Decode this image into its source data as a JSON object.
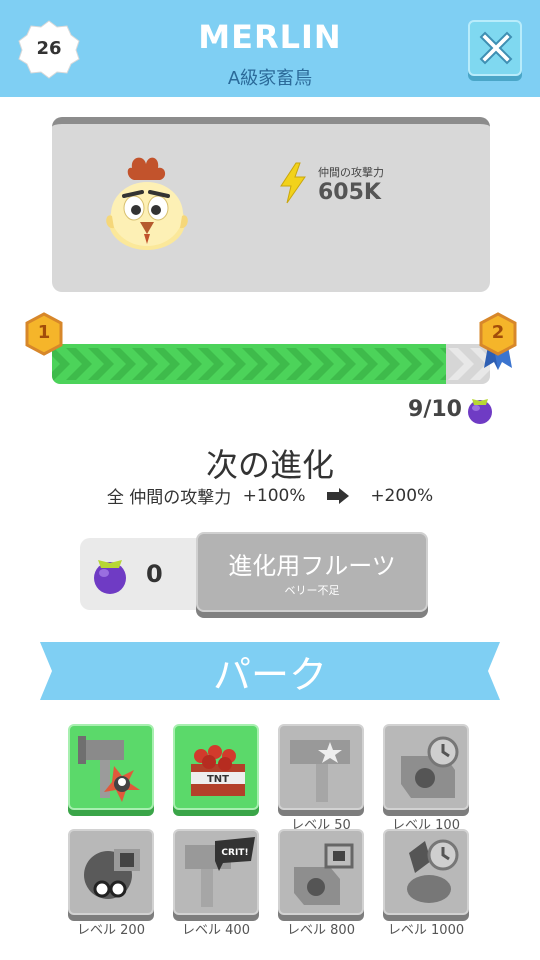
{
  "header": {
    "level": "26",
    "hero_name": "MERLIN",
    "hero_rank": "A級家畜鳥"
  },
  "hero_card": {
    "power_label": "仲間の攻撃力",
    "power_value": "605K"
  },
  "progress": {
    "current": 9,
    "max": 10,
    "count_text": "9/10",
    "from_milestone": "1",
    "to_milestone": "2"
  },
  "next_evolution": {
    "title": "次の進化",
    "bonus_prefix": "全 仲間の攻撃力",
    "bonus_from": "+100%",
    "bonus_to": "+200%"
  },
  "fruit": {
    "count": "0",
    "button_label": "進化用フルーツ",
    "button_sublabel": "ベリー不足"
  },
  "perks": {
    "title": "パーク",
    "tiles": [
      {
        "name": "hammer-crow-perk",
        "state": "unlocked",
        "label": ""
      },
      {
        "name": "tnt-perk",
        "state": "unlocked",
        "label": ""
      },
      {
        "name": "hammer-star-perk",
        "state": "locked",
        "label": "レベル 50"
      },
      {
        "name": "speaker-clock-perk",
        "state": "locked",
        "label": "レベル 100"
      },
      {
        "name": "crow-glasses-perk",
        "state": "locked",
        "label": "レベル 200"
      },
      {
        "name": "crit-hammer-perk",
        "state": "locked",
        "label": "レベル 400"
      },
      {
        "name": "speaker-perk",
        "state": "locked",
        "label": "レベル 800"
      },
      {
        "name": "diamond-clock-perk",
        "state": "locked",
        "label": "レベル 1000"
      }
    ]
  },
  "colors": {
    "header_bg": "#7fcff3",
    "progress_green": "#4cd35a",
    "tile_unlocked": "#5bd96a",
    "tile_locked": "#b8b8b8",
    "berry_purple": "#6f3bc4"
  }
}
